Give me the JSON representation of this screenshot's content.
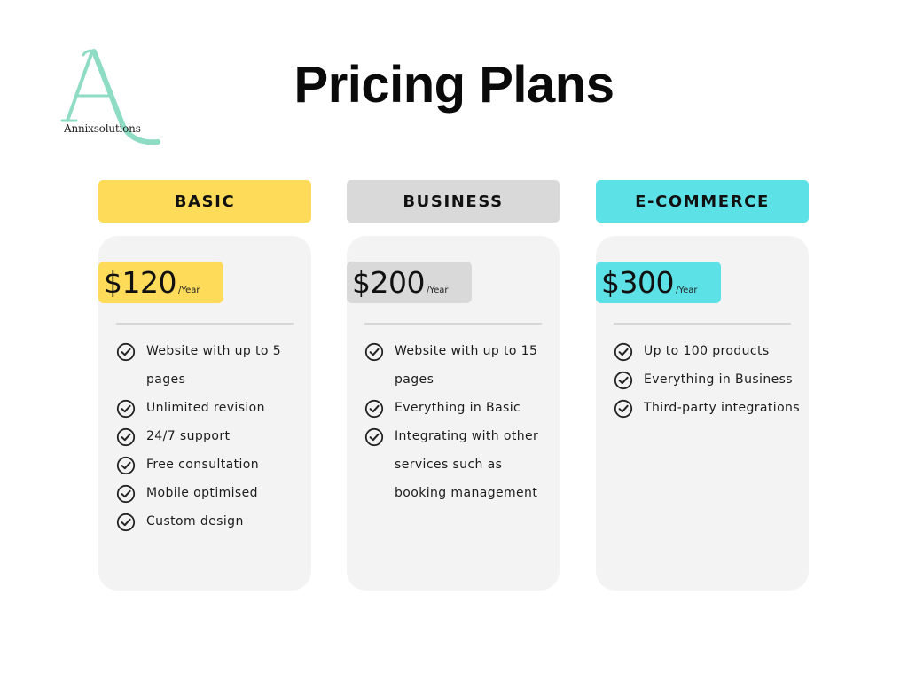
{
  "logo": {
    "letter": "A",
    "name": "Annixsolutions",
    "accent": "#8fdcc4"
  },
  "title": "Pricing Plans",
  "plans": [
    {
      "name": "BASIC",
      "color": "#fedc5a",
      "price": "$120",
      "unit": "/Year",
      "features": [
        "Website with up to 5 pages",
        "Unlimited revision",
        "24/7 support",
        "Free consultation",
        "Mobile optimised",
        "Custom design"
      ]
    },
    {
      "name": "BUSINESS",
      "color": "#d9d9d9",
      "price": "$200",
      "unit": "/Year",
      "features": [
        "Website with up to 15 pages",
        "Everything in Basic",
        "Integrating with other services such as booking management"
      ]
    },
    {
      "name": "E-COMMERCE",
      "color": "#5ce1e6",
      "price": "$300",
      "unit": "/Year",
      "features": [
        "Up to 100 products",
        "Everything in Business",
        "Third-party integrations"
      ]
    }
  ],
  "icons": {
    "feature": "check-circle-icon"
  },
  "colors": {
    "card_bg": "#f3f3f3",
    "divider": "#d6d6d6"
  }
}
